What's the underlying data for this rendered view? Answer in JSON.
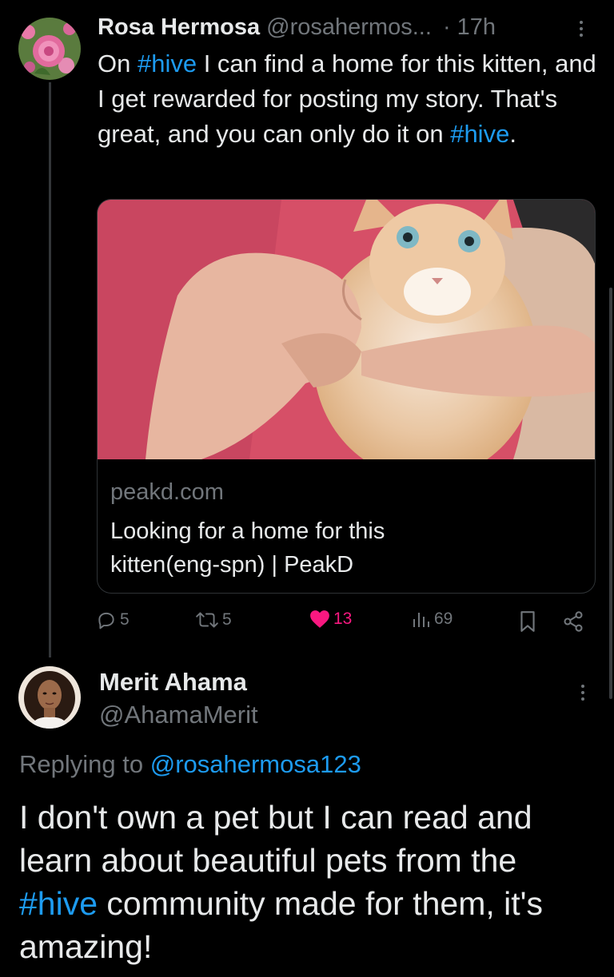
{
  "tweet": {
    "author_name": "Rosa Hermosa",
    "author_handle": "@rosahermos...",
    "time": "· 17h",
    "text_parts": {
      "p1": "On ",
      "tag1": "#hive",
      "p2": " I can find a home for this kitten, and I get rewarded for posting my story. That's great, and you can only do it on ",
      "tag2": "#hive",
      "p3": "."
    },
    "card": {
      "domain": "peakd.com",
      "title": "Looking for a home for this kitten(eng-spn) | PeakD"
    },
    "actions": {
      "replies": "5",
      "retweets": "5",
      "likes": "13",
      "views": "69"
    }
  },
  "reply": {
    "author_name": "Merit Ahama",
    "author_handle": "@AhamaMerit",
    "replying_prefix": "Replying to ",
    "replying_handle": "@rosahermosa123",
    "text_parts": {
      "p1": "I don't own a pet but I can read and learn about beautiful pets from the ",
      "tag1": "#hive",
      "p2": " community made for them, it's amazing!"
    }
  },
  "colors": {
    "background": "#000000",
    "link": "#1d9bf0",
    "like": "#f91880",
    "muted": "#71767b"
  }
}
